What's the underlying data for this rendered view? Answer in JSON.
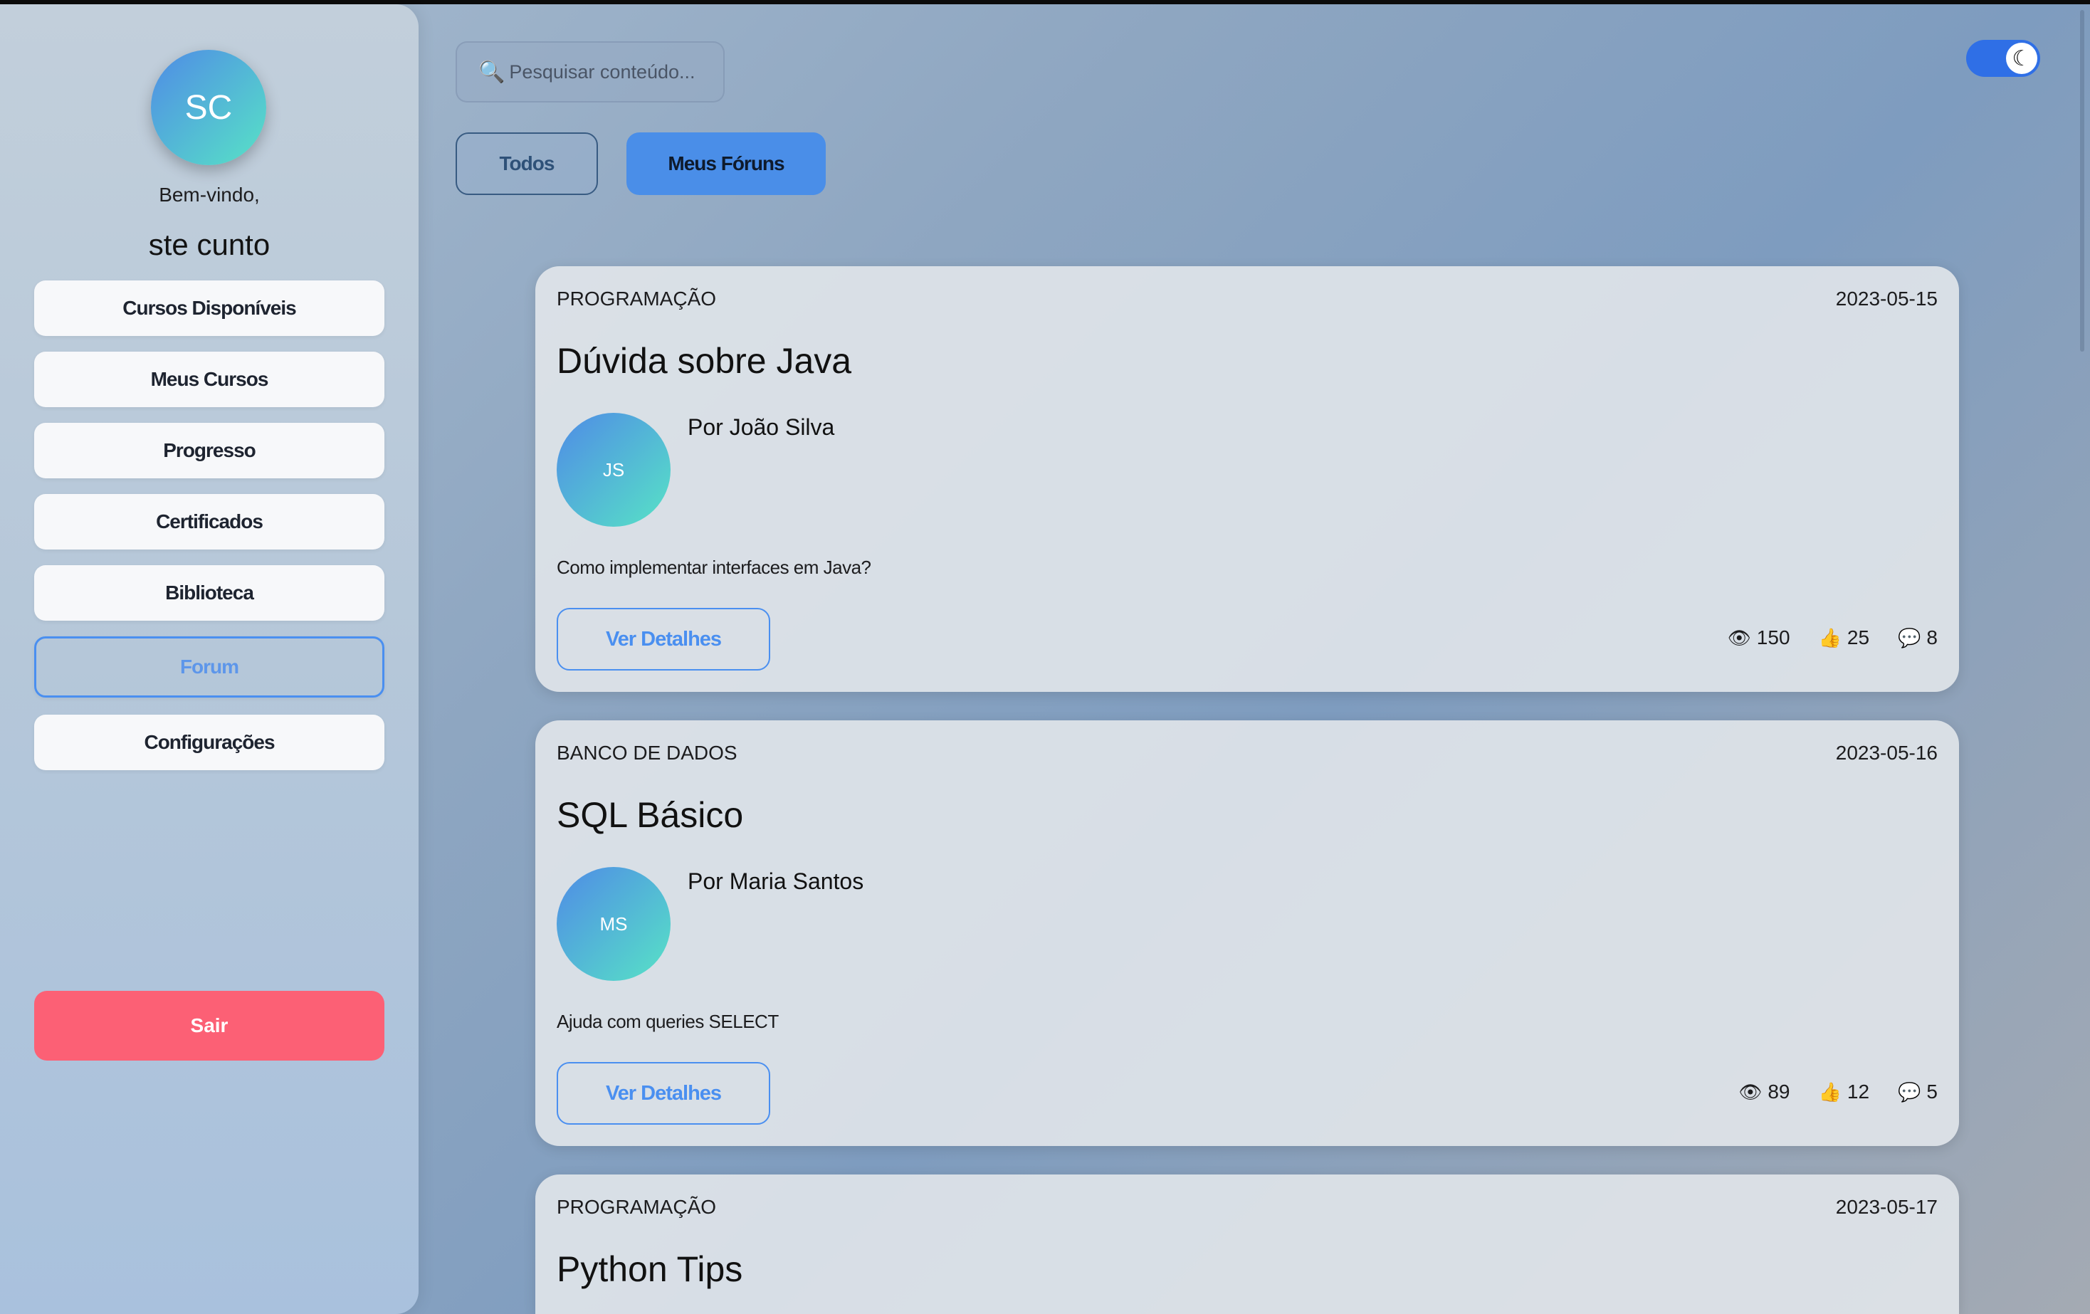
{
  "sidebar": {
    "avatar_initials": "SC",
    "welcome": "Bem-vindo,",
    "username": "ste cunto",
    "nav": [
      {
        "label": "Cursos Disponíveis"
      },
      {
        "label": "Meus Cursos"
      },
      {
        "label": "Progresso"
      },
      {
        "label": "Certificados"
      },
      {
        "label": "Biblioteca"
      },
      {
        "label": "Forum",
        "active": true
      },
      {
        "label": "Configurações"
      }
    ],
    "logout": "Sair"
  },
  "search": {
    "placeholder": "Pesquisar conteúdo..."
  },
  "filters": {
    "all": "Todos",
    "mine": "Meus Fóruns"
  },
  "theme_toggle": {
    "icon": "moon-icon",
    "on": true
  },
  "posts": [
    {
      "category": "PROGRAMAÇÃO",
      "date": "2023-05-15",
      "title": "Dúvida sobre Java",
      "initials": "JS",
      "author": "Por João Silva",
      "description": "Como implementar interfaces em Java?",
      "button": "Ver Detalhes",
      "views": "150",
      "likes": "25",
      "comments": "8"
    },
    {
      "category": "BANCO DE DADOS",
      "date": "2023-05-16",
      "title": "SQL Básico",
      "initials": "MS",
      "author": "Por Maria Santos",
      "description": "Ajuda com queries SELECT",
      "button": "Ver Detalhes",
      "views": "89",
      "likes": "12",
      "comments": "5"
    },
    {
      "category": "PROGRAMAÇÃO",
      "date": "2023-05-17",
      "title": "Python Tips"
    }
  ]
}
